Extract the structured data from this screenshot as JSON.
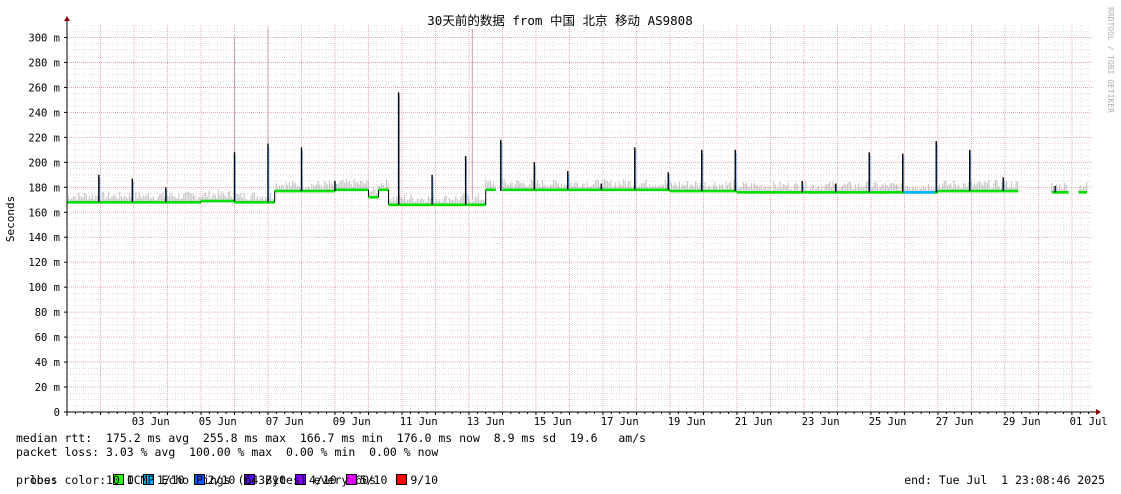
{
  "chart_data": {
    "type": "line",
    "title": "30天前的数据 from 中国 北京 移动 AS9808",
    "ylabel": "Seconds",
    "watermark": "RRDTOOL / TOBI OETIKER",
    "y_ticks": [
      "0",
      "20 m",
      "40 m",
      "60 m",
      "80 m",
      "100 m",
      "120 m",
      "140 m",
      "160 m",
      "180 m",
      "200 m",
      "220 m",
      "240 m",
      "260 m",
      "280 m",
      "300 m"
    ],
    "ylim": [
      0,
      310
    ],
    "x_ticks": [
      {
        "day": 2.5,
        "label": "03 Jun"
      },
      {
        "day": 4.5,
        "label": "05 Jun"
      },
      {
        "day": 6.5,
        "label": "07 Jun"
      },
      {
        "day": 8.5,
        "label": "09 Jun"
      },
      {
        "day": 10.5,
        "label": "11 Jun"
      },
      {
        "day": 12.5,
        "label": "13 Jun"
      },
      {
        "day": 14.5,
        "label": "15 Jun"
      },
      {
        "day": 16.5,
        "label": "17 Jun"
      },
      {
        "day": 18.5,
        "label": "19 Jun"
      },
      {
        "day": 20.5,
        "label": "21 Jun"
      },
      {
        "day": 22.5,
        "label": "23 Jun"
      },
      {
        "day": 24.5,
        "label": "25 Jun"
      },
      {
        "day": 26.5,
        "label": "27 Jun"
      },
      {
        "day": 28.5,
        "label": "29 Jun"
      },
      {
        "day": 30.5,
        "label": "01 Jul"
      }
    ],
    "x_day_range": [
      0,
      30.6
    ],
    "grid": true,
    "median_segments": [
      {
        "from": 0.0,
        "to": 4.0,
        "ms": 168
      },
      {
        "from": 4.0,
        "to": 5.0,
        "ms": 169
      },
      {
        "from": 5.0,
        "to": 5.5,
        "ms": 168
      },
      {
        "from": 5.5,
        "to": 6.2,
        "ms": 168
      },
      {
        "from": 6.2,
        "to": 6.4,
        "ms": 177
      },
      {
        "from": 6.4,
        "to": 8.0,
        "ms": 177
      },
      {
        "from": 8.0,
        "to": 8.9,
        "ms": 178
      },
      {
        "from": 8.9,
        "to": 9.0,
        "ms": 178
      },
      {
        "from": 9.0,
        "to": 9.3,
        "ms": 172
      },
      {
        "from": 9.3,
        "to": 9.6,
        "ms": 178
      },
      {
        "from": 9.6,
        "to": 12.0,
        "ms": 166
      },
      {
        "from": 12.0,
        "to": 12.5,
        "ms": 166
      },
      {
        "from": 12.5,
        "to": 12.8,
        "ms": 178
      },
      {
        "from": 13.0,
        "to": 16.0,
        "ms": 178
      },
      {
        "from": 16.0,
        "to": 18.0,
        "ms": 178
      },
      {
        "from": 18.0,
        "to": 20.0,
        "ms": 177
      },
      {
        "from": 20.0,
        "to": 24.0,
        "ms": 176
      },
      {
        "from": 24.0,
        "to": 25.0,
        "ms": 176
      },
      {
        "from": 25.0,
        "to": 26.0,
        "ms": 176
      },
      {
        "from": 26.0,
        "to": 27.0,
        "ms": 177
      },
      {
        "from": 27.0,
        "to": 28.4,
        "ms": 177
      },
      {
        "from": 29.4,
        "to": 29.9,
        "ms": 176
      },
      {
        "from": 30.2,
        "to": 30.45,
        "ms": 176
      }
    ],
    "spikes": [
      {
        "day": 0.95,
        "ms": 190
      },
      {
        "day": 1.95,
        "ms": 187
      },
      {
        "day": 2.95,
        "ms": 180
      },
      {
        "day": 5.0,
        "ms": 208
      },
      {
        "day": 6.0,
        "ms": 215
      },
      {
        "day": 7.0,
        "ms": 212
      },
      {
        "day": 8.0,
        "ms": 185
      },
      {
        "day": 9.9,
        "ms": 256
      },
      {
        "day": 10.9,
        "ms": 190
      },
      {
        "day": 11.9,
        "ms": 205
      },
      {
        "day": 12.95,
        "ms": 218
      },
      {
        "day": 13.95,
        "ms": 200
      },
      {
        "day": 14.95,
        "ms": 193
      },
      {
        "day": 15.95,
        "ms": 183
      },
      {
        "day": 16.95,
        "ms": 212
      },
      {
        "day": 17.95,
        "ms": 192
      },
      {
        "day": 18.95,
        "ms": 210
      },
      {
        "day": 19.95,
        "ms": 210
      },
      {
        "day": 21.95,
        "ms": 185
      },
      {
        "day": 22.95,
        "ms": 183
      },
      {
        "day": 23.95,
        "ms": 208
      },
      {
        "day": 24.95,
        "ms": 207
      },
      {
        "day": 25.95,
        "ms": 217
      },
      {
        "day": 26.95,
        "ms": 210
      },
      {
        "day": 27.95,
        "ms": 188
      },
      {
        "day": 29.5,
        "ms": 181
      }
    ],
    "outlier_lines": [
      {
        "day": 5.0,
        "ms": 300
      },
      {
        "day": 6.0,
        "ms": 307
      },
      {
        "day": 12.1,
        "ms": 307
      }
    ],
    "loss_segments": [
      {
        "from": 25.0,
        "to": 25.9,
        "color": "#00b8ff"
      }
    ],
    "colors": {
      "median": "#00e000",
      "smoke": "#b4b4b4",
      "spike": "#000000",
      "grid_minor": "#e6b2b2",
      "grid_major": "#de9aa1",
      "axis": "#000000",
      "arrow": "#8b0000"
    }
  },
  "stats": {
    "median_rtt": "median rtt:  175.2 ms avg  255.8 ms max  166.7 ms min  176.0 ms now  8.9 ms sd  19.6   am/s",
    "packet_loss": "packet loss: 3.03 % avg  100.00 % max  0.00 % min  0.00 % now",
    "loss_color_label": "loss color: ",
    "probe": "probe:       10 ICMP Echo Pings (64 Bytes) every 60s",
    "end": "end: Tue Jul  1 23:08:46 2025"
  },
  "loss_legend": [
    {
      "label": "0",
      "color": "#26ff00"
    },
    {
      "label": "1/10",
      "color": "#00b8ff"
    },
    {
      "label": "2/10",
      "color": "#0059ff"
    },
    {
      "label": "3/10",
      "color": "#5e00ff"
    },
    {
      "label": "4/10",
      "color": "#7e00ff"
    },
    {
      "label": "5/10",
      "color": "#dd00ff"
    },
    {
      "label": "9/10",
      "color": "#ff0000"
    }
  ]
}
